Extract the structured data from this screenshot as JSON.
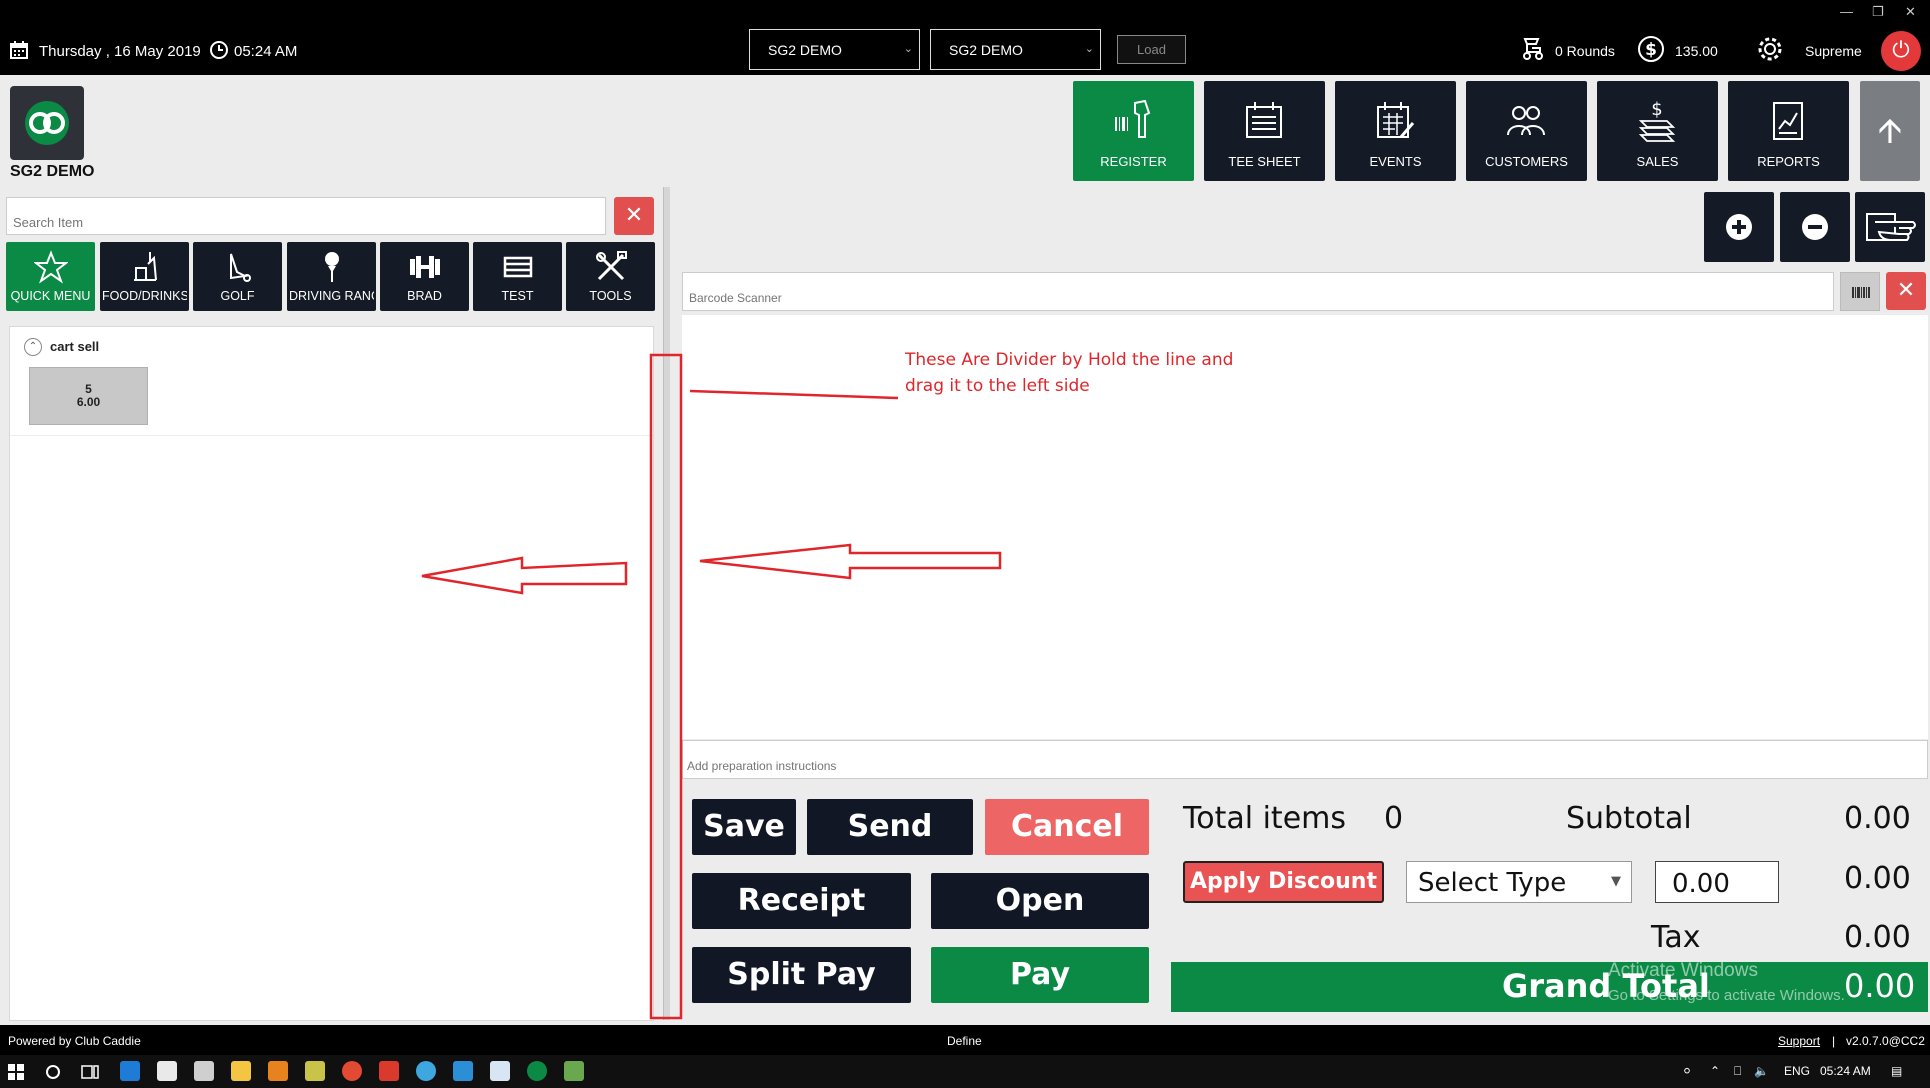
{
  "topbar": {
    "date": "Thursday ,  16 May 2019",
    "time": "05:24 AM",
    "select1": "SG2 DEMO",
    "select2": "SG2 DEMO",
    "load_label": "Load",
    "rounds": "0 Rounds",
    "balance": "135.00",
    "user": "Supreme"
  },
  "header": {
    "company": "SG2 DEMO",
    "nav": [
      "REGISTER",
      "TEE SHEET",
      "EVENTS",
      "CUSTOMERS",
      "SALES",
      "REPORTS"
    ]
  },
  "left": {
    "search_placeholder": "Search Item",
    "categories": [
      "QUICK MENU",
      "FOOD/DRINKS",
      "GOLF",
      "DRIVING RANG",
      "BRAD",
      "TEST",
      "TOOLS"
    ],
    "group_name": "cart sell",
    "item": {
      "name": "5",
      "price": "6.00"
    }
  },
  "right": {
    "barcode_placeholder": "Barcode Scanner",
    "prep_placeholder": "Add preparation instructions",
    "annotation": "These Are Divider by Hold the line and drag it to the left side"
  },
  "actions": {
    "save": "Save",
    "send": "Send",
    "cancel": "Cancel",
    "receipt": "Receipt",
    "open": "Open",
    "split_pay": "Split Pay",
    "pay": "Pay"
  },
  "totals": {
    "total_items_label": "Total items",
    "total_items": "0",
    "subtotal_label": "Subtotal",
    "subtotal": "0.00",
    "apply_discount": "Apply Discount",
    "select_type": "Select Type",
    "discount_input": "0.00",
    "discount_value": "0.00",
    "tax_label": "Tax",
    "tax": "0.00",
    "grand_total_label": "Grand Total",
    "grand_total": "0.00"
  },
  "watermark": {
    "line1": "Activate Windows",
    "line2": "Go to Settings to activate Windows."
  },
  "statusbar": {
    "powered": "Powered by Club Caddie",
    "define": "Define",
    "support": "Support",
    "separator": "|",
    "version": "v2.0.7.0@CC2"
  },
  "taskbar": {
    "lang": "ENG",
    "time": "05:24 AM"
  },
  "colors": {
    "accent_green": "#0a8a45",
    "dark_button": "#111725",
    "danger_red": "#e95353"
  }
}
